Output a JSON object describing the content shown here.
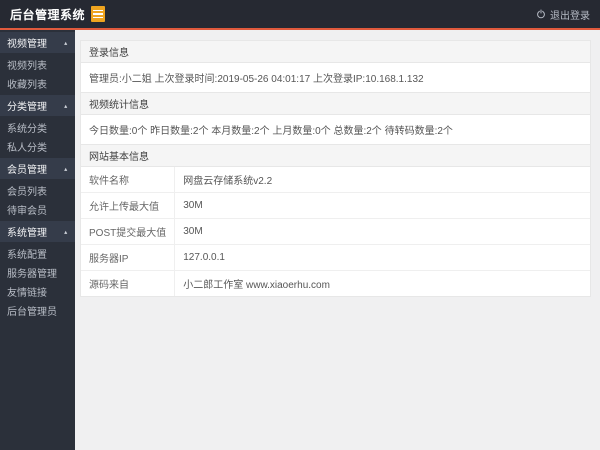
{
  "header": {
    "title": "后台管理系统",
    "logout_label": "退出登录",
    "accent_color": "#e05a3d",
    "logo_color": "#efa41f"
  },
  "sidebar": {
    "caret": "▴",
    "items": [
      {
        "label": "视频管理",
        "type": "group"
      },
      {
        "label": "视频列表",
        "type": "item"
      },
      {
        "label": "收藏列表",
        "type": "item"
      },
      {
        "label": "分类管理",
        "type": "group"
      },
      {
        "label": "系统分类",
        "type": "item"
      },
      {
        "label": "私人分类",
        "type": "item"
      },
      {
        "label": "会员管理",
        "type": "group"
      },
      {
        "label": "会员列表",
        "type": "item"
      },
      {
        "label": "待审会员",
        "type": "item"
      },
      {
        "label": "系统管理",
        "type": "group"
      },
      {
        "label": "系统配置",
        "type": "item"
      },
      {
        "label": "服务器管理",
        "type": "item"
      },
      {
        "label": "友情链接",
        "type": "item"
      },
      {
        "label": "后台管理员",
        "type": "item"
      }
    ]
  },
  "main": {
    "login_panel": {
      "title": "登录信息",
      "content": "管理员:小二姐 上次登录时间:2019-05-26 04:01:17 上次登录IP:10.168.1.132"
    },
    "video_stats_panel": {
      "title": "视频统计信息",
      "content": "今日数量:0个 昨日数量:2个 本月数量:2个 上月数量:0个 总数量:2个 待转码数量:2个"
    },
    "site_info_panel": {
      "title": "网站基本信息",
      "rows": [
        {
          "label": "软件名称",
          "value": "网盘云存储系统v2.2"
        },
        {
          "label": "允许上传最大值",
          "value": "30M"
        },
        {
          "label": "POST提交最大值",
          "value": "30M"
        },
        {
          "label": "服务器IP",
          "value": "127.0.0.1"
        },
        {
          "label": "源码来自",
          "value": "小二郎工作室 www.xiaoerhu.com"
        }
      ]
    }
  }
}
